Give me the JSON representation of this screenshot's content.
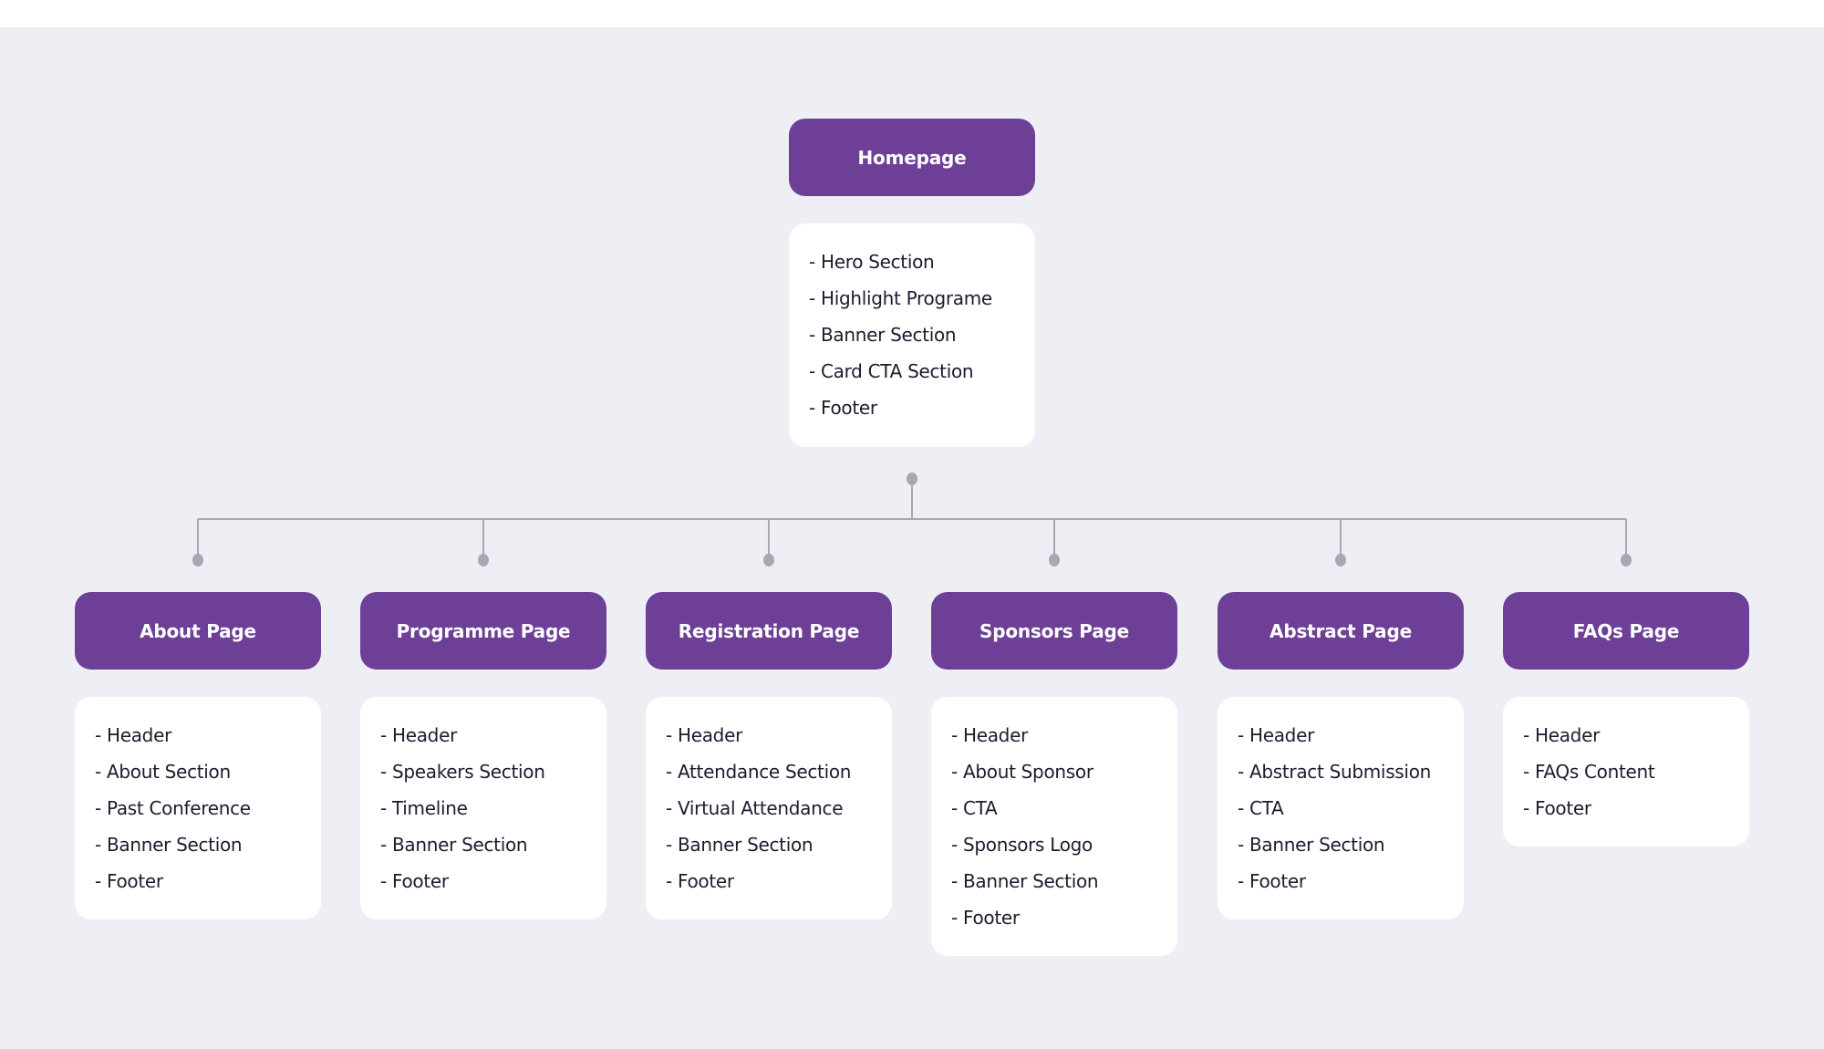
{
  "diagram": {
    "type": "sitemap-tree",
    "colors": {
      "header_bg": "#6D3F96",
      "header_text": "#FFFFFF",
      "card_bg": "#FFFFFF",
      "card_text": "#1B1D2E",
      "canvas_bg": "#EEEFF4",
      "connector": "#A7A8B4"
    },
    "root": {
      "title": "Homepage",
      "sections": [
        "- Hero Section",
        "- Highlight Programe",
        "- Banner Section",
        "- Card CTA Section",
        "- Footer"
      ]
    },
    "children": [
      {
        "title": "About Page",
        "sections": [
          "- Header",
          "- About Section",
          "- Past Conference",
          "- Banner Section",
          "- Footer"
        ]
      },
      {
        "title": "Programme Page",
        "sections": [
          "- Header",
          "- Speakers Section",
          "- Timeline",
          "- Banner Section",
          "- Footer"
        ]
      },
      {
        "title": "Registration Page",
        "sections": [
          "- Header",
          "- Attendance  Section",
          "- Virtual Attendance",
          "- Banner Section",
          "- Footer"
        ]
      },
      {
        "title": "Sponsors Page",
        "sections": [
          "- Header",
          "- About Sponsor",
          "- CTA",
          "- Sponsors Logo",
          "- Banner Section",
          "- Footer"
        ]
      },
      {
        "title": "Abstract Page",
        "sections": [
          "- Header",
          "- Abstract Submission",
          "- CTA",
          "- Banner Section",
          "- Footer"
        ]
      },
      {
        "title": "FAQs Page",
        "sections": [
          "- Header",
          "- FAQs Content",
          "- Footer"
        ]
      }
    ]
  }
}
